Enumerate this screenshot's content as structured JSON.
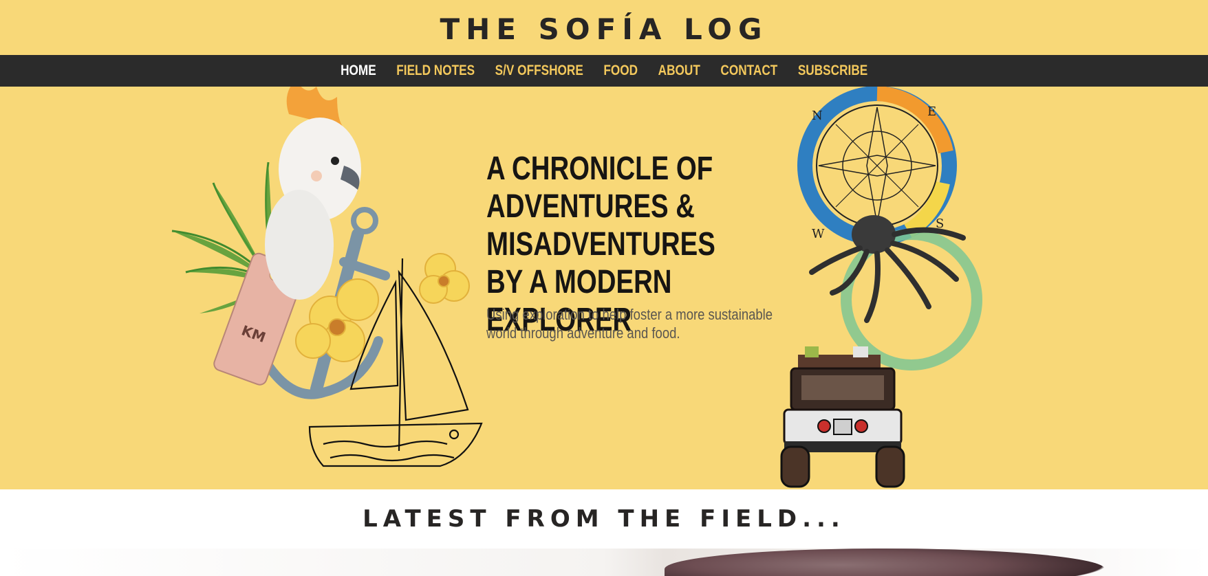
{
  "header": {
    "title": "THE SOFÍA LOG"
  },
  "nav": {
    "items": [
      {
        "label": "HOME",
        "active": true
      },
      {
        "label": "FIELD NOTES"
      },
      {
        "label": "S/V OFFSHORE"
      },
      {
        "label": "FOOD"
      },
      {
        "label": "ABOUT"
      },
      {
        "label": "CONTACT"
      },
      {
        "label": "SUBSCRIBE"
      }
    ]
  },
  "hero": {
    "heading": "A CHRONICLE OF ADVENTURES & MISADVENTURES BY A MODERN EXPLORER",
    "subtext": "Using exploration to help foster a more sustainable world through adventure and food.",
    "compass_letters": [
      "N",
      "E",
      "S",
      "W"
    ],
    "luggage_tag_text": "KM"
  },
  "latest": {
    "title": "LATEST FROM THE FIELD..."
  },
  "colors": {
    "background": "#f8d878",
    "nav_bg": "#2b2b2b",
    "nav_text": "#f3c85c",
    "nav_active": "#ffffff",
    "text_dark": "#272524"
  }
}
